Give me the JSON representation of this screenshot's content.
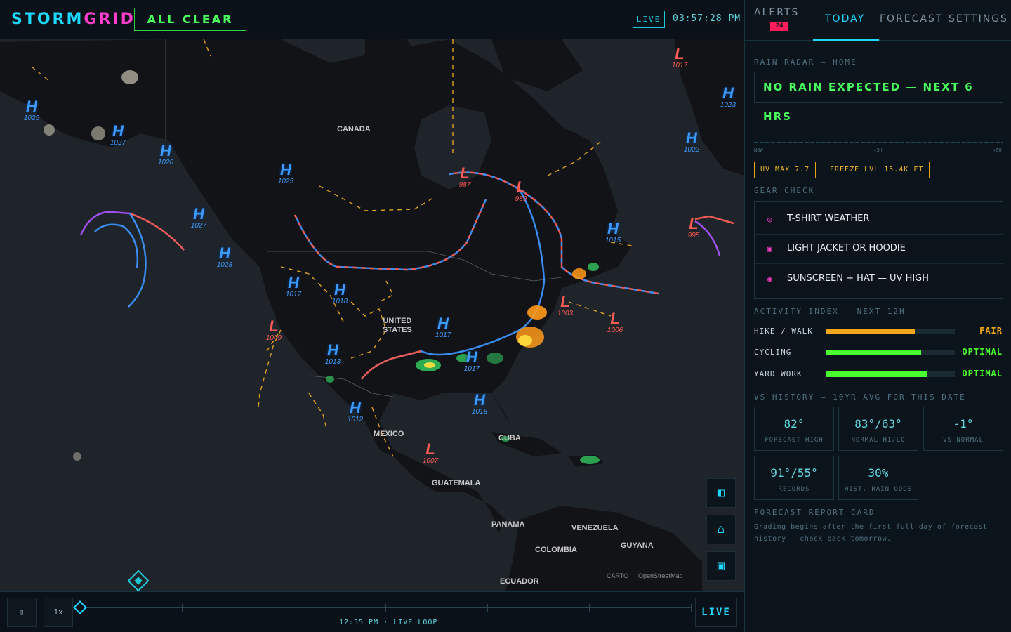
{
  "header": {
    "brand_part1": "STORM",
    "brand_part2": "GRID",
    "status": "ALL CLEAR",
    "live_badge": "LIVE",
    "clock": "03:57:28 PM"
  },
  "map": {
    "labels": {
      "canada": "CANADA",
      "us_line1": "UNITED",
      "us_line2": "STATES",
      "mexico": "MEXICO",
      "cuba": "CUBA",
      "guatemala": "GUATEMALA",
      "panama": "PANAMA",
      "venezuela": "VENEZUELA",
      "guyana": "GUYANA",
      "colombia": "COLOMBIA",
      "ecuador": "ECUADOR"
    },
    "pressure_centers": [
      {
        "type": "H",
        "value": "1025"
      },
      {
        "type": "H",
        "value": "1027"
      },
      {
        "type": "H",
        "value": "1028"
      },
      {
        "type": "H",
        "value": "1025"
      },
      {
        "type": "H",
        "value": "1027"
      },
      {
        "type": "H",
        "value": "1028"
      },
      {
        "type": "H",
        "value": "1017"
      },
      {
        "type": "H",
        "value": "1018"
      },
      {
        "type": "H",
        "value": "1017"
      },
      {
        "type": "H",
        "value": "1013"
      },
      {
        "type": "H",
        "value": "1017"
      },
      {
        "type": "H",
        "value": "1012"
      },
      {
        "type": "H",
        "value": "1018"
      },
      {
        "type": "H",
        "value": "1015"
      },
      {
        "type": "H",
        "value": "1022"
      },
      {
        "type": "H",
        "value": "1023"
      },
      {
        "type": "L",
        "value": "1017"
      },
      {
        "type": "L",
        "value": "987"
      },
      {
        "type": "L",
        "value": "989"
      },
      {
        "type": "L",
        "value": "995"
      },
      {
        "type": "L",
        "value": "1003"
      },
      {
        "type": "L",
        "value": "1006"
      },
      {
        "type": "L",
        "value": "1009"
      },
      {
        "type": "L",
        "value": "1007"
      }
    ],
    "attribution": [
      "CARTO",
      "OpenStreetMap"
    ]
  },
  "timeline": {
    "play_glyph": "▯",
    "speed": "1x",
    "time_label": "12:55 PM · LIVE LOOP",
    "live": "LIVE",
    "ticks": 7
  },
  "panel": {
    "tabs": {
      "alerts": "ALERTS",
      "alerts_count": "24",
      "today": "TODAY",
      "forecast": "FORECAST",
      "settings": "SETTINGS"
    },
    "rain": {
      "title": "RAIN RADAR — HOME",
      "message": "NO RAIN EXPECTED — NEXT 6 HRS",
      "axis": [
        "NOW",
        "+3H",
        "+6H"
      ]
    },
    "chips": [
      "UV MAX 7.7",
      "FREEZE LVL 15.4K FT"
    ],
    "gear": {
      "title": "GEAR CHECK",
      "items": [
        "T-SHIRT WEATHER",
        "LIGHT JACKET OR HOODIE",
        "SUNSCREEN + HAT — UV HIGH"
      ]
    },
    "activity": {
      "title": "ACTIVITY INDEX — NEXT 12H",
      "items": [
        {
          "label": "HIKE / WALK",
          "level": 0.69,
          "state": "FAIR",
          "color": "#f0a81a"
        },
        {
          "label": "CYCLING",
          "level": 0.74,
          "state": "OPTIMAL",
          "color": "#49ff2e"
        },
        {
          "label": "YARD WORK",
          "level": 0.79,
          "state": "OPTIMAL",
          "color": "#49ff2e"
        }
      ]
    },
    "history": {
      "title": "VS HISTORY — 10YR AVG FOR THIS DATE",
      "stats": [
        {
          "value": "82°",
          "label": "FORECAST HIGH"
        },
        {
          "value": "83°/63°",
          "label": "NORMAL HI/LO"
        },
        {
          "value": "-1°",
          "label": "VS NORMAL"
        },
        {
          "value": "91°/55°",
          "label": "RECORDS"
        },
        {
          "value": "30%",
          "label": "HIST. RAIN ODDS"
        }
      ]
    },
    "report": {
      "title": "FORECAST REPORT CARD",
      "text": "Grading begins after the first full day of forecast history — check back tomorrow."
    }
  },
  "colors": {
    "accent_cyan": "#1ed8ff",
    "accent_magenta": "#ff3dcb",
    "status_green": "#49ff5e",
    "warning_amber": "#f0a81a",
    "high_pressure": "#3c9bff",
    "low_pressure": "#ff5a55"
  }
}
